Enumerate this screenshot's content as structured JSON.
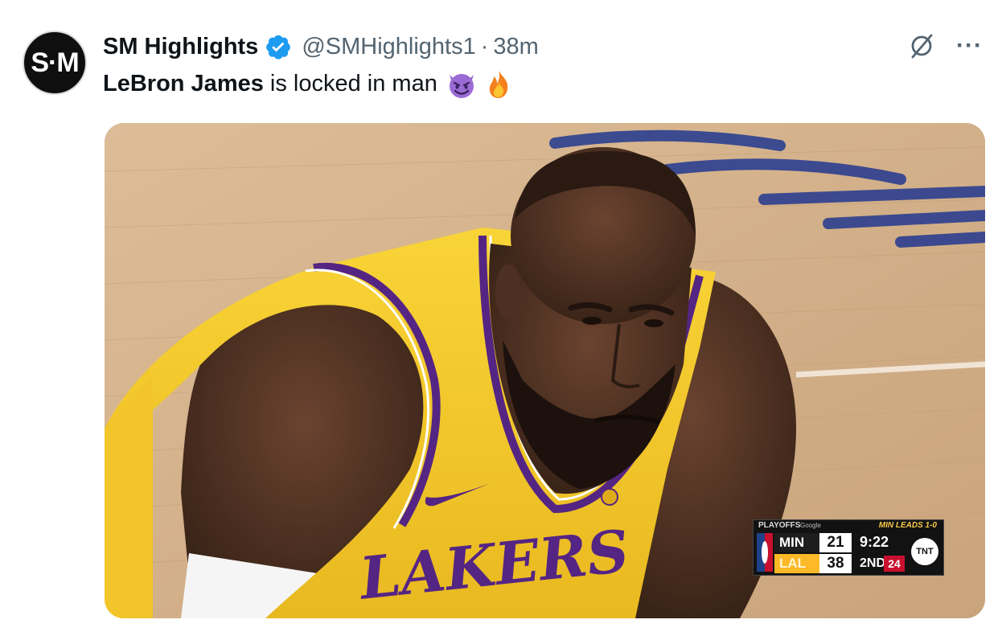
{
  "avatar": {
    "text": "S·M",
    "icon": "sm-logo-avatar"
  },
  "author": {
    "display_name": "SM Highlights",
    "handle": "@SMHighlights1",
    "separator": "·",
    "time": "38m"
  },
  "actions": {
    "grok_icon": "grok-icon",
    "more_label": "···"
  },
  "tweet": {
    "mention": "LeBron James",
    "text": " is locked in man",
    "emojis": [
      "smiling-devil-emoji",
      "fire-emoji"
    ]
  },
  "scorebug": {
    "series_left": "PLAYOFFS",
    "sponsor": "Google",
    "series_right": "MIN LEADS 1-0",
    "team1": "MIN",
    "score1": "21",
    "team2": "LAL",
    "score2": "38",
    "clock": "9:22",
    "quarter": "2ND",
    "shot_clock": "24",
    "network": "TNT"
  },
  "colors": {
    "verified": "#1d9bf0",
    "lakers_gold": "#fdb927",
    "lakers_purple": "#552583",
    "text_primary": "#0f1419",
    "text_secondary": "#536471"
  }
}
